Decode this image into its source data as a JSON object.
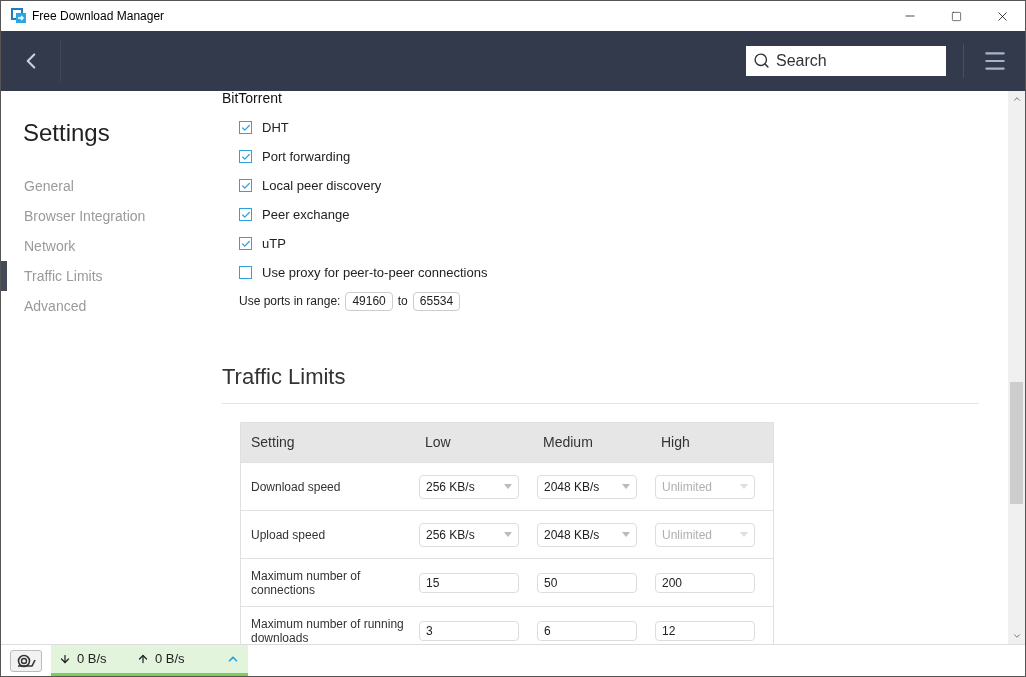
{
  "window": {
    "title": "Free Download Manager"
  },
  "header": {
    "search": {
      "placeholder": "Search"
    }
  },
  "sidebar": {
    "title": "Settings",
    "items": [
      {
        "label": "General",
        "selected": false
      },
      {
        "label": "Browser Integration",
        "selected": false
      },
      {
        "label": "Network",
        "selected": false
      },
      {
        "label": "Traffic Limits",
        "selected": true
      },
      {
        "label": "Advanced",
        "selected": false
      }
    ]
  },
  "bittorrent": {
    "heading": "BitTorrent",
    "options": [
      {
        "label": "DHT",
        "checked": true
      },
      {
        "label": "Port forwarding",
        "checked": true
      },
      {
        "label": "Local peer discovery",
        "checked": true
      },
      {
        "label": "Peer exchange",
        "checked": true
      },
      {
        "label": "uTP",
        "checked": true
      },
      {
        "label": "Use proxy for peer-to-peer connections",
        "checked": false
      }
    ],
    "ports": {
      "label": "Use ports in range:",
      "from": "49160",
      "separator": "to",
      "to": "65534"
    }
  },
  "traffic_limits": {
    "heading": "Traffic Limits",
    "columns": [
      "Setting",
      "Low",
      "Medium",
      "High"
    ],
    "rows": [
      {
        "cells": [
          {
            "kind": "text",
            "value": "Download speed",
            "disabled": false
          },
          {
            "kind": "select",
            "value": "256 KB/s",
            "disabled": false
          },
          {
            "kind": "select",
            "value": "2048 KB/s",
            "disabled": false
          },
          {
            "kind": "select",
            "value": "Unlimited",
            "disabled": true
          }
        ]
      },
      {
        "cells": [
          {
            "kind": "text",
            "value": "Upload speed",
            "disabled": false
          },
          {
            "kind": "select",
            "value": "256 KB/s",
            "disabled": false
          },
          {
            "kind": "select",
            "value": "2048 KB/s",
            "disabled": false
          },
          {
            "kind": "select",
            "value": "Unlimited",
            "disabled": true
          }
        ]
      },
      {
        "cells": [
          {
            "kind": "text",
            "value": "Maximum number of connections",
            "disabled": false
          },
          {
            "kind": "input",
            "value": "15",
            "disabled": false
          },
          {
            "kind": "input",
            "value": "50",
            "disabled": false
          },
          {
            "kind": "input",
            "value": "200",
            "disabled": false
          }
        ]
      },
      {
        "cells": [
          {
            "kind": "text",
            "value": "Maximum number of running downloads",
            "disabled": false
          },
          {
            "kind": "input",
            "value": "3",
            "disabled": false
          },
          {
            "kind": "input",
            "value": "6",
            "disabled": false
          },
          {
            "kind": "input",
            "value": "12",
            "disabled": false
          }
        ]
      }
    ]
  },
  "status_bar": {
    "download": "0 B/s",
    "upload": "0 B/s"
  }
}
